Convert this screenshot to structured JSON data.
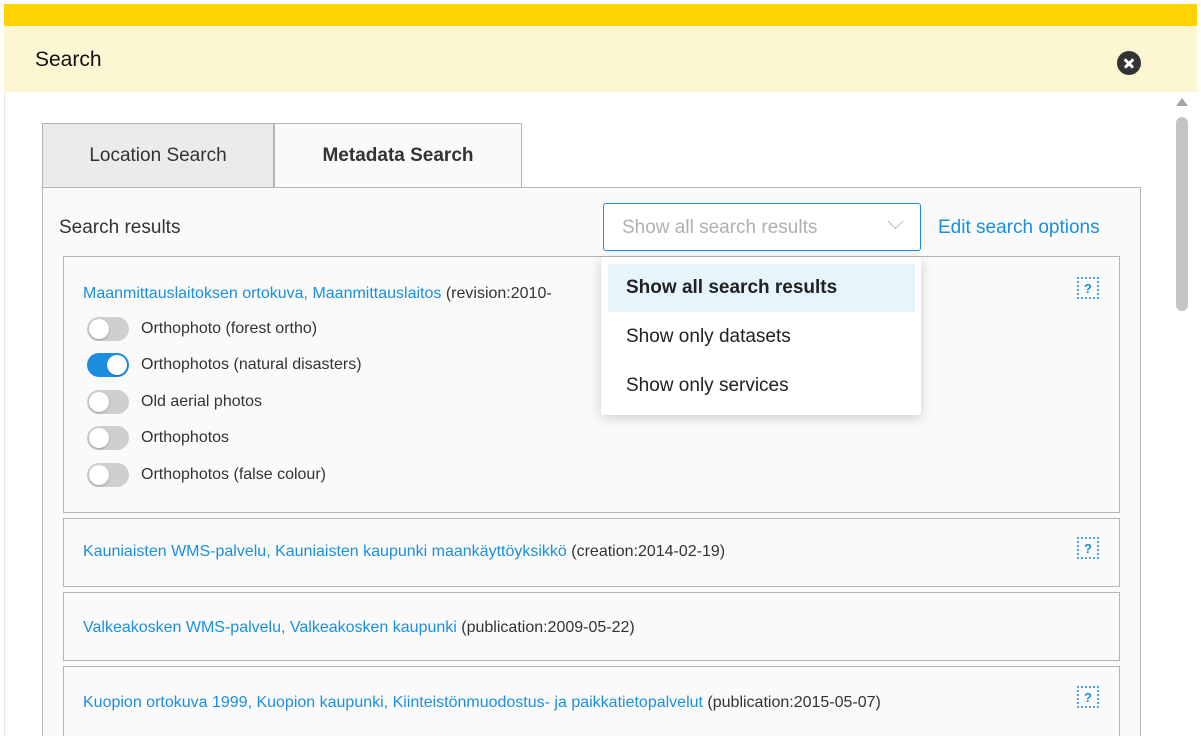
{
  "header": {
    "title": "Search"
  },
  "tabs": [
    {
      "label": "Location Search"
    },
    {
      "label": "Metadata Search"
    }
  ],
  "search_results_label": "Search results",
  "filter": {
    "selected": "Show all search results",
    "options": [
      "Show all search results",
      "Show only datasets",
      "Show only services"
    ]
  },
  "edit_search_options": "Edit search options",
  "results": [
    {
      "title": "Maanmittauslaitoksen ortokuva, Maanmittauslaitos",
      "meta": "(revision:2010-",
      "layers": [
        {
          "label": "Orthophoto (forest ortho)",
          "on": false
        },
        {
          "label": "Orthophotos (natural disasters)",
          "on": true
        },
        {
          "label": "Old aerial photos",
          "on": false
        },
        {
          "label": "Orthophotos",
          "on": false
        },
        {
          "label": "Orthophotos (false colour)",
          "on": false
        }
      ]
    },
    {
      "title": "Kauniaisten WMS-palvelu, Kauniaisten kaupunki maankäyttöyksikkö",
      "meta": "(creation:2014-02-19)"
    },
    {
      "title": "Valkeakosken WMS-palvelu, Valkeakosken kaupunki",
      "meta": "(publication:2009-05-22)"
    },
    {
      "title": "Kuopion ortokuva 1999, Kuopion kaupunki, Kiinteistönmuodostus- ja paikkatietopalvelut",
      "meta": "(publication:2015-05-07)"
    }
  ],
  "info_icon_glyph": "?",
  "colors": {
    "accent": "#1a8fe0",
    "header_bar": "#ffd400",
    "header_bg": "#fdf6d3"
  }
}
